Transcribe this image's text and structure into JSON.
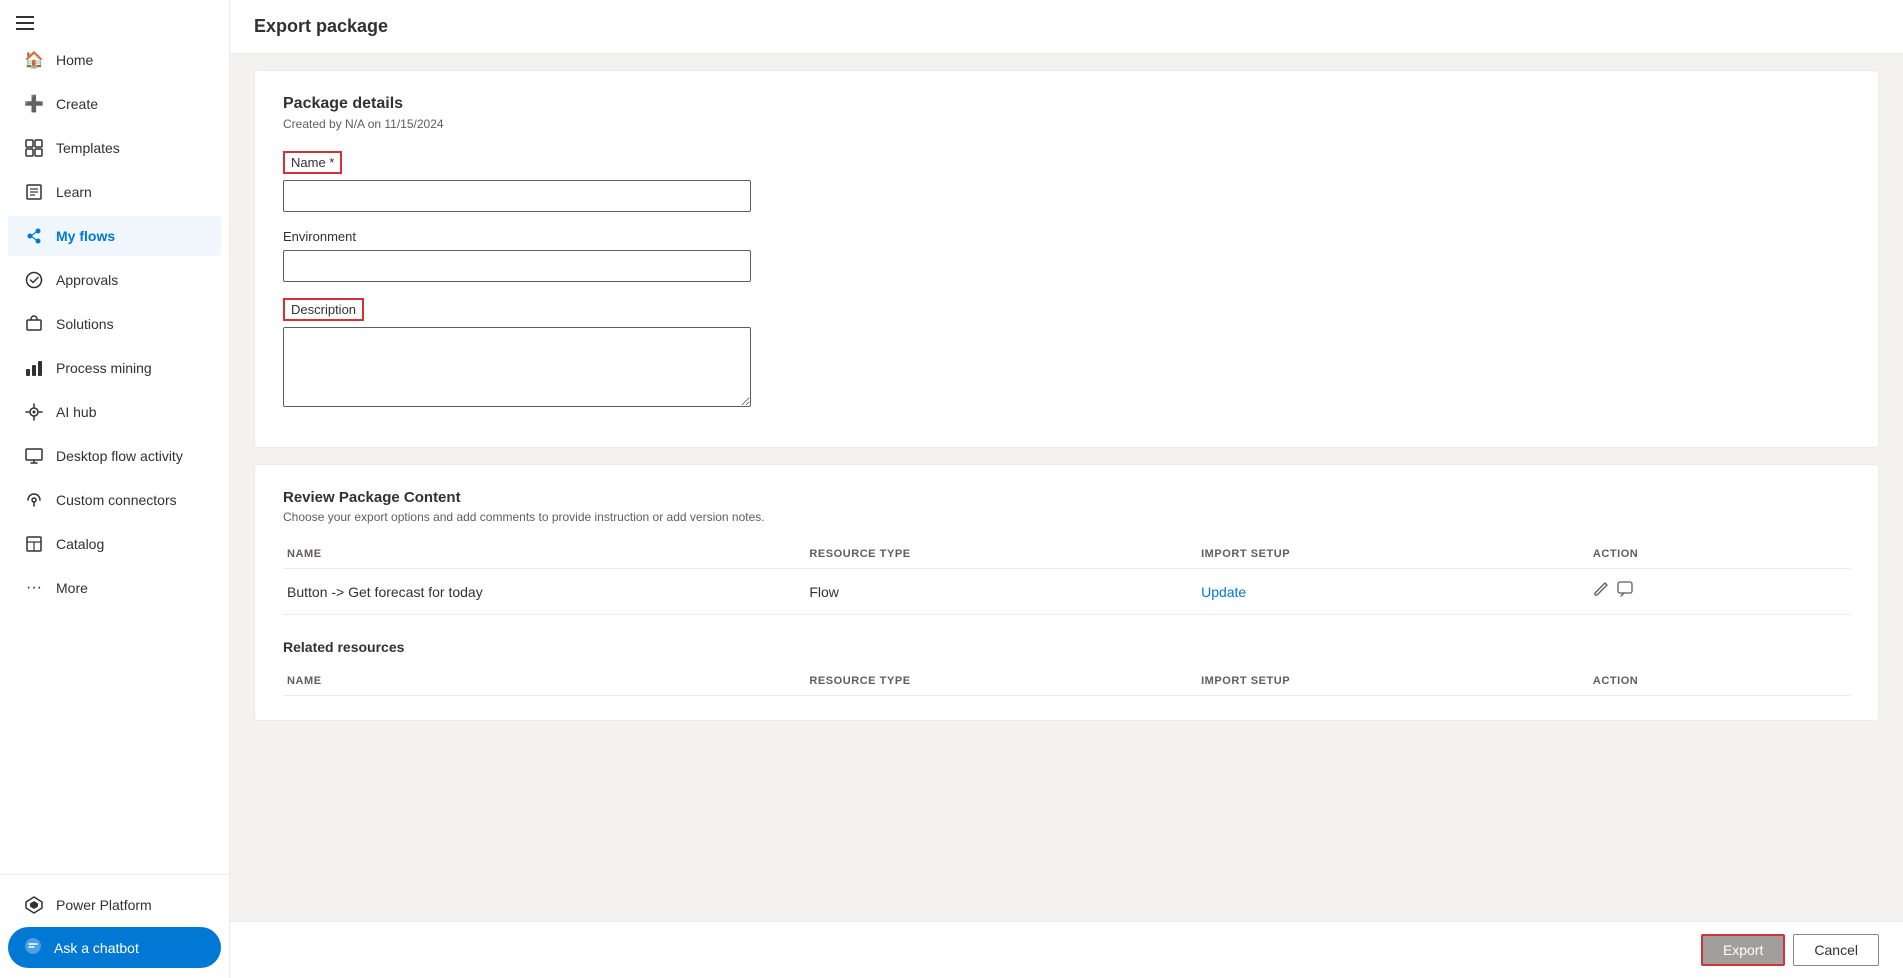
{
  "page": {
    "title": "Export package"
  },
  "sidebar": {
    "items": [
      {
        "id": "home",
        "label": "Home",
        "icon": "🏠",
        "active": false
      },
      {
        "id": "create",
        "label": "Create",
        "icon": "➕",
        "active": false
      },
      {
        "id": "templates",
        "label": "Templates",
        "icon": "📄",
        "active": false
      },
      {
        "id": "learn",
        "label": "Learn",
        "icon": "📖",
        "active": false
      },
      {
        "id": "my-flows",
        "label": "My flows",
        "icon": "🔵",
        "active": true
      },
      {
        "id": "approvals",
        "label": "Approvals",
        "icon": "✅",
        "active": false
      },
      {
        "id": "solutions",
        "label": "Solutions",
        "icon": "💡",
        "active": false
      },
      {
        "id": "process-mining",
        "label": "Process mining",
        "icon": "📊",
        "active": false
      },
      {
        "id": "ai-hub",
        "label": "AI hub",
        "icon": "🤖",
        "active": false
      },
      {
        "id": "desktop-flow-activity",
        "label": "Desktop flow activity",
        "icon": "🖥️",
        "active": false
      },
      {
        "id": "custom-connectors",
        "label": "Custom connectors",
        "icon": "🔗",
        "active": false
      },
      {
        "id": "catalog",
        "label": "Catalog",
        "icon": "📦",
        "active": false
      },
      {
        "id": "more",
        "label": "More",
        "icon": "...",
        "active": false
      }
    ],
    "bottom": {
      "power_platform_label": "Power Platform",
      "chatbot_label": "Ask a chatbot"
    }
  },
  "package_details": {
    "section_title": "Package details",
    "subtitle": "Created by N/A on 11/15/2024",
    "name_label": "Name *",
    "name_placeholder": "",
    "name_value": "",
    "environment_label": "Environment",
    "environment_placeholder": "",
    "environment_value": "",
    "description_label": "Description",
    "description_placeholder": "",
    "description_value": ""
  },
  "review_package": {
    "section_title": "Review Package Content",
    "section_desc": "Choose your export options and add comments to provide instruction or add version notes.",
    "table_headers": [
      "NAME",
      "RESOURCE TYPE",
      "IMPORT SETUP",
      "ACTION"
    ],
    "rows": [
      {
        "name": "Button -> Get forecast for today",
        "resource_type": "Flow",
        "import_setup": "Update",
        "action": "edit_comment"
      }
    ]
  },
  "related_resources": {
    "title": "Related resources",
    "table_headers": [
      "NAME",
      "RESOURCE TYPE",
      "IMPORT SETUP",
      "ACTION"
    ]
  },
  "footer": {
    "export_label": "Export",
    "cancel_label": "Cancel"
  }
}
